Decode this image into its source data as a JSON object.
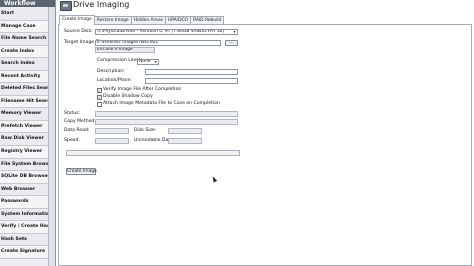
{
  "sidebar": {
    "title": "Workflow",
    "items": [
      "Start",
      "Manage Case",
      "File Name Search",
      "Create Index",
      "Search Index",
      "Recent Activity",
      "Deleted Files Search",
      "Filename Hit Search",
      "Memory Viewer",
      "Prefetch Viewer",
      "Raw Disk Viewer",
      "Registry Viewer",
      "File System Browser",
      "SQLite DB Browser",
      "Web Browser",
      "Passwords",
      "System Information",
      "Verify / Create Hash",
      "Hash Sets",
      "Create Signature"
    ]
  },
  "window": {
    "title": "Drive Imaging"
  },
  "tabs": [
    {
      "label": "Create Image",
      "active": true
    },
    {
      "label": "Restore Image",
      "active": false
    },
    {
      "label": "Hidden Areas",
      "active": false
    },
    {
      "label": "HPA/DCO",
      "active": false
    },
    {
      "label": "RAID Rebuild",
      "active": false
    }
  ],
  "form": {
    "source_disk_label": "Source Disk:",
    "source_disk_value": "\\\\.\\PhysicalDrive0 - Partition 0, M: [7.60GB VANI35 FAT 32]",
    "target_file_label": "Target Image File:",
    "target_file_value": "E:\\Forensic Images\\Test.e01",
    "browse_label": "...",
    "format_value": "EnCase 6 Image",
    "compression_label": "Compression Level:",
    "compression_value": "None",
    "description_label": "Description:",
    "location_label": "Location/Place:",
    "verify_label": "Verify Image File After Completion",
    "verify_checked": true,
    "disable_shadow_label": "Disable Shadow Copy",
    "disable_shadow_checked": true,
    "attach_label": "Attach Image Metadata File to Case on Completion",
    "attach_checked": false,
    "status_label": "Status:",
    "copy_method_label": "Copy Method:",
    "data_read_label": "Data Read:",
    "disk_size_label": "Disk Size:",
    "speed_label": "Speed:",
    "unreadable_label": "Unreadable Data:",
    "progress": 0,
    "create_button_label": "Create Image"
  },
  "colors": {
    "sidebar_header": "#5a6472",
    "progress_fill": "#3f9a48"
  }
}
